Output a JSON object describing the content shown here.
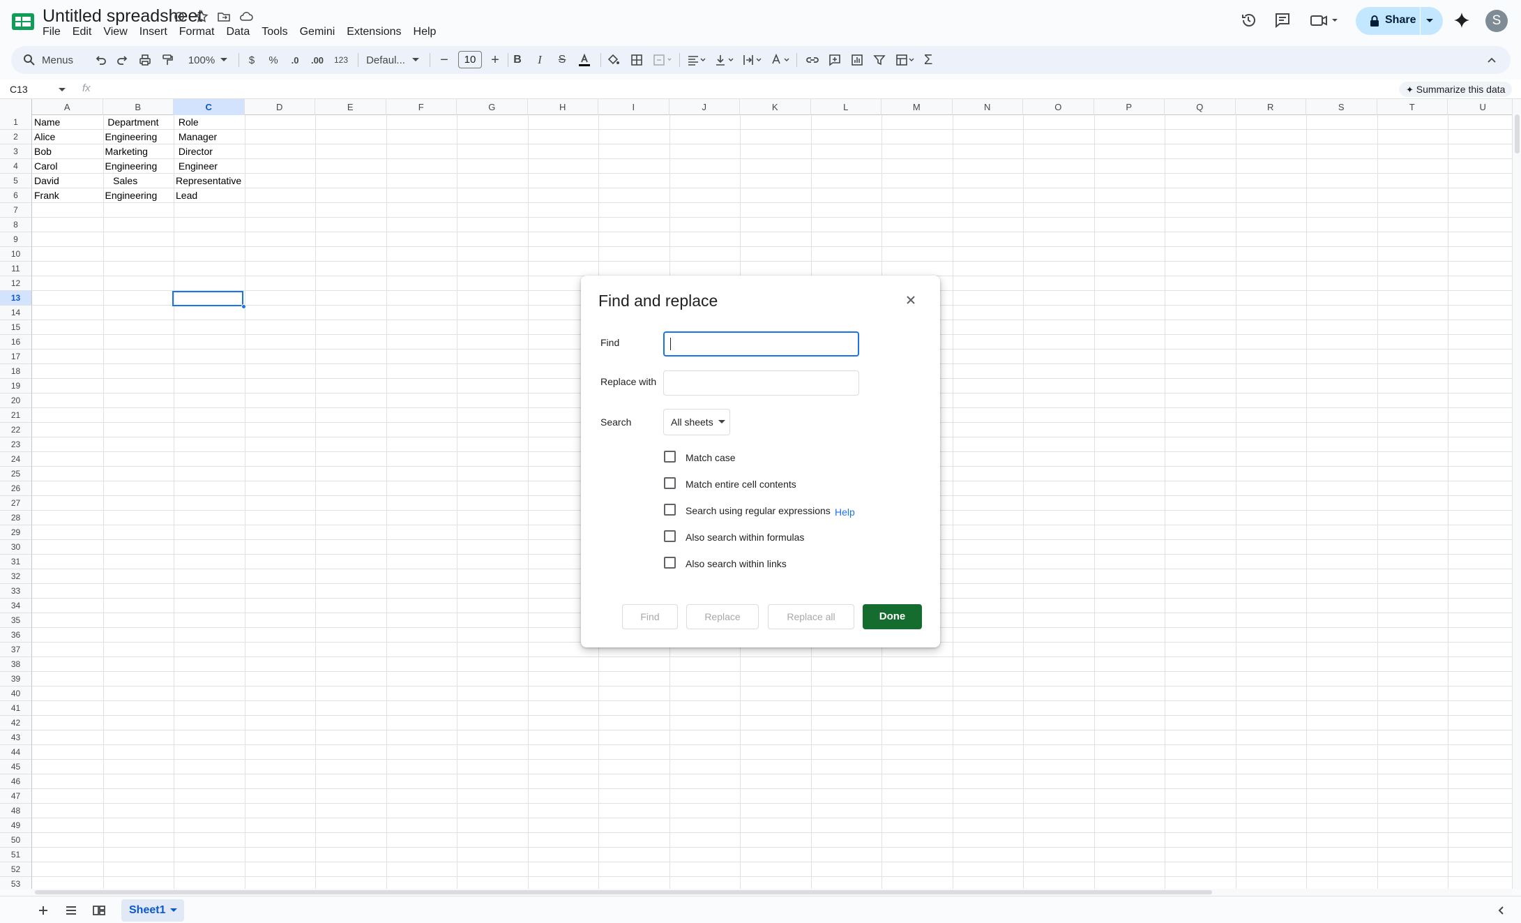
{
  "app": {
    "title": "Untitled spreadsheet"
  },
  "menubar": [
    "File",
    "Edit",
    "View",
    "Insert",
    "Format",
    "Data",
    "Tools",
    "Gemini",
    "Extensions",
    "Help"
  ],
  "header": {
    "share_label": "Share",
    "avatar_initial": "S"
  },
  "toolbar": {
    "search_menus": "Menus",
    "zoom": "100%",
    "currency": "$",
    "percent": "%",
    "dec_decrease": ".0",
    "dec_increase": ".00",
    "number_format": "123",
    "font": "Defaul...",
    "font_size": "10"
  },
  "formula_bar": {
    "name_box": "C13",
    "fx": "fx",
    "summarize": "Summarize this data"
  },
  "grid": {
    "columns": [
      "A",
      "B",
      "C",
      "D",
      "E",
      "F",
      "G",
      "H",
      "I",
      "J",
      "K",
      "L",
      "M",
      "N",
      "O",
      "P",
      "Q",
      "R",
      "S",
      "T",
      "U"
    ],
    "selected_column": "C",
    "selected_row": 13,
    "row_count": 53,
    "cells": [
      [
        "Name",
        " Department",
        " Role"
      ],
      [
        "Alice",
        "Engineering",
        " Manager"
      ],
      [
        "Bob",
        "Marketing",
        " Director"
      ],
      [
        "Carol",
        "Engineering",
        " Engineer"
      ],
      [
        "David",
        "   Sales",
        "Representative"
      ],
      [
        "Frank",
        "Engineering",
        "Lead"
      ]
    ]
  },
  "sheets": {
    "active": "Sheet1"
  },
  "dialog": {
    "title": "Find and replace",
    "find_label": "Find",
    "find_value": "",
    "replace_label": "Replace with",
    "replace_value": "",
    "search_label": "Search",
    "search_scope": "All sheets",
    "options": [
      {
        "label": "Match case",
        "checked": false
      },
      {
        "label": "Match entire cell contents",
        "checked": false
      },
      {
        "label": "Search using regular expressions",
        "checked": false
      },
      {
        "label": "Also search within formulas",
        "checked": false
      },
      {
        "label": "Also search within links",
        "checked": false
      }
    ],
    "help_link": "Help",
    "buttons": {
      "find": "Find",
      "replace": "Replace",
      "replace_all": "Replace all",
      "done": "Done"
    }
  },
  "colors": {
    "accent": "#1a73e8",
    "done": "#146c2e",
    "share_bg": "#c2e7ff"
  }
}
